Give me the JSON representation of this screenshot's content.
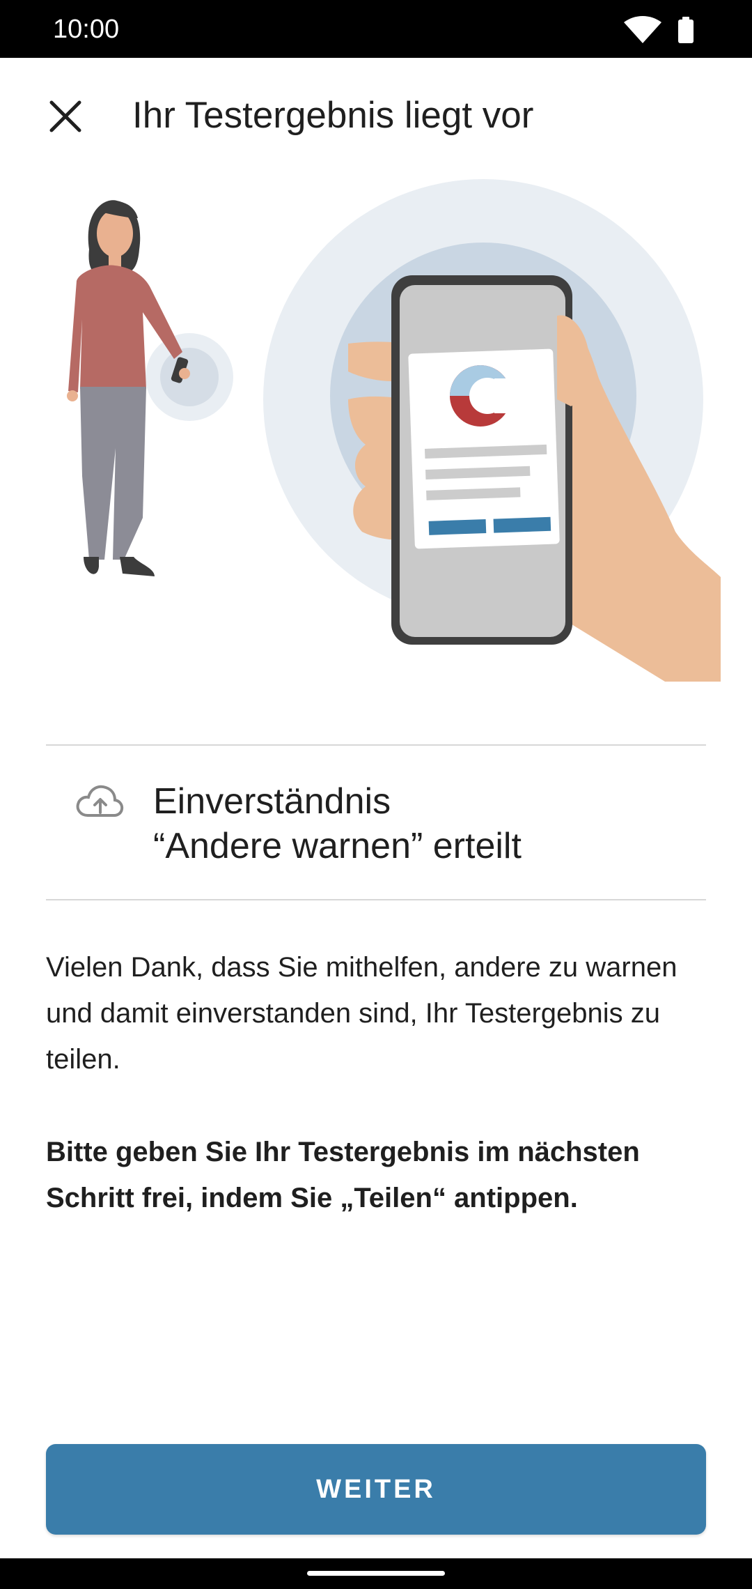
{
  "status": {
    "time": "10:00"
  },
  "header": {
    "title": "Ihr Testergebnis liegt vor"
  },
  "consent": {
    "title_line1": "Einverständnis",
    "title_line2": "“Andere warnen” erteilt"
  },
  "body": {
    "paragraph": "Vielen Dank, dass Sie mithelfen, andere zu warnen und damit einverstanden sind, Ihr Testergebnis zu teilen.",
    "bold_paragraph": "Bitte geben Sie Ihr Testergebnis im nächsten Schritt frei, indem Sie „Teilen“ antippen."
  },
  "actions": {
    "primary_label": "WEITER"
  },
  "icons": {
    "close": "close-icon",
    "cloud": "cloud-upload-icon",
    "wifi": "wifi-icon",
    "battery": "battery-icon"
  },
  "colors": {
    "primary": "#3a7daa",
    "divider": "#d7d7d7"
  }
}
